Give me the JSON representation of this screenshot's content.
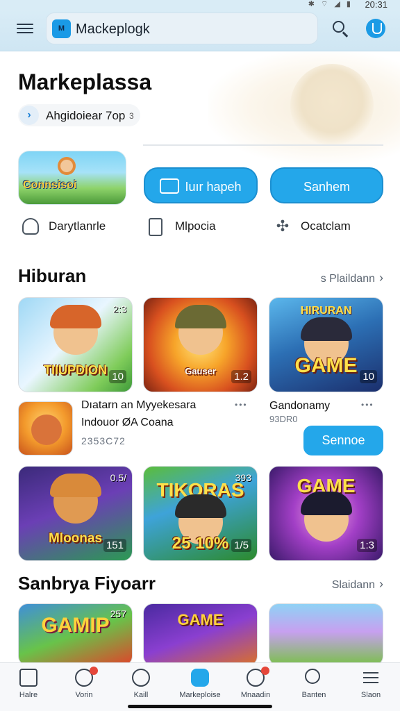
{
  "status_bar": {
    "time": "20:31",
    "icons": "✱ ⌔ ◢ ▮"
  },
  "header": {
    "app_logo_text": "M",
    "search_text": "Mackeplogk"
  },
  "page": {
    "title": "Markeplassa",
    "chip_label": "Ahgidoiear 7op",
    "chip_count": "3"
  },
  "promo": {
    "banner_text": "Connsisoi",
    "button_primary": "Iuır hapeh",
    "button_secondary": "Sanhem"
  },
  "quick_links": [
    {
      "label": "Darytlanrle",
      "icon": "profile-icon"
    },
    {
      "label": "Mlpocia",
      "icon": "document-icon"
    },
    {
      "label": "Ocatclam",
      "icon": "puzzle-icon"
    }
  ],
  "section_1": {
    "title": "Hiburan",
    "see_all": "s Plaildann",
    "tiles": [
      {
        "title": "TIIUPDION",
        "badge": "2:3",
        "count": "10"
      },
      {
        "title": "Gauser",
        "badge": "",
        "count": "1.2"
      },
      {
        "top": "HIRURAN",
        "title": "GAME",
        "badge": "",
        "count": "10"
      }
    ],
    "list_left": {
      "title": "Dıatarn an Myyekesara",
      "subtitle": "Indouor ØA Coana",
      "meta": "2353C72",
      "more": "•••"
    },
    "list_right": {
      "title": "Gandonamy",
      "meta": "93DR0",
      "more": "•••",
      "button": "Sennoe"
    },
    "tiles_2": [
      {
        "title": "Mloonas",
        "badge": "0.5/",
        "count": "151"
      },
      {
        "top": "TIKORAS",
        "title": "25 10%",
        "badge": "393",
        "count": "1/5"
      },
      {
        "top": "GAME",
        "title": "",
        "badge": "",
        "count": "1:3"
      }
    ]
  },
  "section_2": {
    "title": "Sanbrya Fiyoarr",
    "see_all": "Slaidann",
    "tiles": [
      {
        "top": "GAMIP",
        "badge": "257"
      },
      {
        "top": "GAME",
        "badge": ""
      },
      {
        "top": "",
        "badge": ""
      }
    ]
  },
  "bottom_nav": [
    {
      "label": "Halre",
      "icon": "home-icon"
    },
    {
      "label": "Vorin",
      "icon": "emoji-icon",
      "dot": true
    },
    {
      "label": "Kaill",
      "icon": "gear-icon"
    },
    {
      "label": "Markeploise",
      "icon": "marketplace-icon",
      "active": true
    },
    {
      "label": "Mnaadin",
      "icon": "profile-icon",
      "dot": true
    },
    {
      "label": "Banten",
      "icon": "search-icon"
    },
    {
      "label": "Slaon",
      "icon": "menu-icon"
    }
  ],
  "colors": {
    "accent": "#24a7ea",
    "topbar": "#d9ecf6",
    "badge": "#e5473a"
  }
}
